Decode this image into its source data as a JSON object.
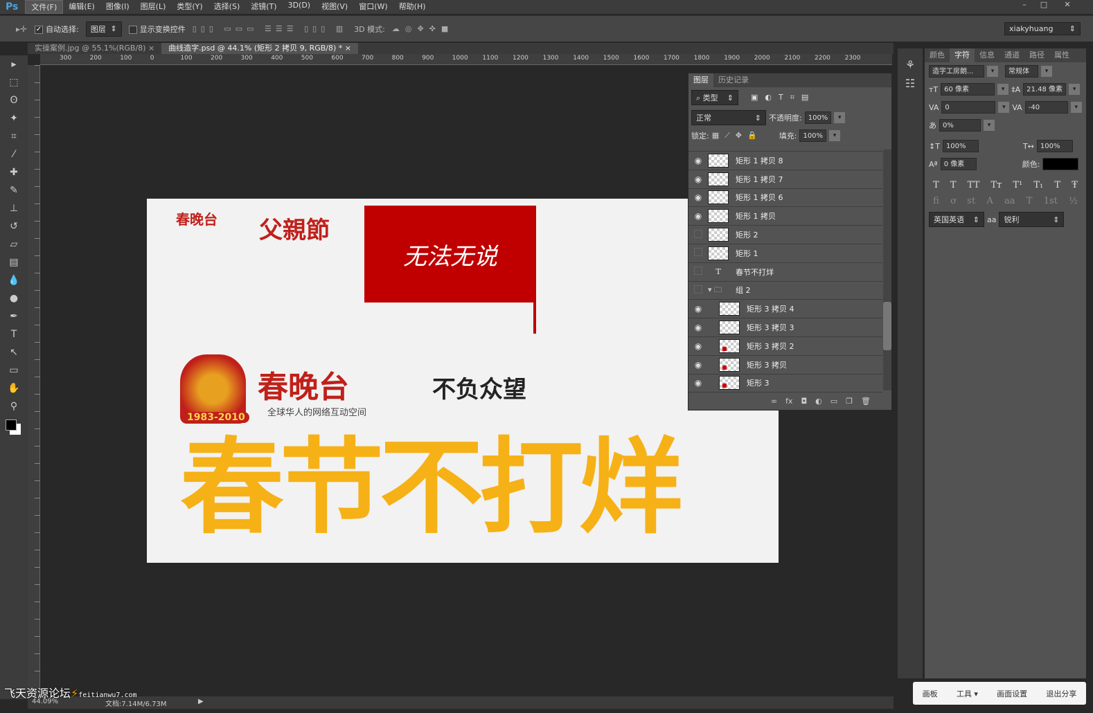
{
  "app": {
    "logo": "Ps",
    "user": "xiakyhuang"
  },
  "menu": [
    "文件(F)",
    "编辑(E)",
    "图像(I)",
    "图层(L)",
    "类型(Y)",
    "选择(S)",
    "滤镜(T)",
    "3D(D)",
    "视图(V)",
    "窗口(W)",
    "帮助(H)"
  ],
  "options": {
    "auto_select_label": "自动选择:",
    "auto_select_value": "图层",
    "show_transform_label": "显示变换控件",
    "mode3d_label": "3D 模式:"
  },
  "tabs": [
    {
      "label": "实操案例.jpg @ 55.1%(RGB/8)",
      "close": "×"
    },
    {
      "label": "曲线造字.psd @ 44.1% (矩形 2 拷贝 9, RGB/8) *",
      "close": "×"
    }
  ],
  "ruler_top": [
    "300",
    "200",
    "100",
    "0",
    "100",
    "200",
    "300",
    "400",
    "500",
    "600",
    "700",
    "800",
    "900",
    "1000",
    "1100",
    "1200",
    "1300",
    "1400",
    "1500",
    "1600",
    "1700",
    "1800",
    "1900",
    "2000",
    "2100",
    "2200",
    "2300"
  ],
  "canvas": {
    "logo1": "春晚台",
    "festival": "父親節",
    "red_box_text": "无法无说",
    "logo2": "春晚台",
    "logo2_years": "1983-2010",
    "logo2_slogan": "全球华人的网络互动空间",
    "black_text": "不负众望",
    "big_text": "春节不打烊",
    "colors": {
      "red": "#c00000",
      "orange": "#f6b117"
    }
  },
  "layers_panel": {
    "tabs": [
      "图层",
      "历史记录"
    ],
    "filter": "类型",
    "blend_mode": "正常",
    "opacity_label": "不透明度:",
    "opacity": "100%",
    "lock_label": "锁定:",
    "fill_label": "填充:",
    "fill": "100%",
    "layers": [
      {
        "name": "矩形 1 拷贝 8",
        "visible": true,
        "type": "raster",
        "indent": false
      },
      {
        "name": "矩形 1 拷贝 7",
        "visible": true,
        "type": "raster",
        "indent": false
      },
      {
        "name": "矩形 1 拷贝 6",
        "visible": true,
        "type": "raster",
        "indent": false
      },
      {
        "name": "矩形 1 拷贝",
        "visible": true,
        "type": "raster",
        "indent": false
      },
      {
        "name": "矩形 2",
        "visible": false,
        "type": "raster",
        "indent": false
      },
      {
        "name": "矩形 1",
        "visible": false,
        "type": "raster",
        "indent": false
      },
      {
        "name": "春节不打烊",
        "visible": false,
        "type": "text",
        "indent": false
      },
      {
        "name": "组 2",
        "visible": false,
        "type": "group",
        "indent": false
      },
      {
        "name": "矩形 3 拷贝 4",
        "visible": true,
        "type": "raster",
        "indent": true
      },
      {
        "name": "矩形 3 拷贝 3",
        "visible": true,
        "type": "raster",
        "indent": true
      },
      {
        "name": "矩形 3 拷贝 2",
        "visible": true,
        "type": "raster-red",
        "indent": true
      },
      {
        "name": "矩形 3 拷贝",
        "visible": true,
        "type": "raster-red",
        "indent": true
      },
      {
        "name": "矩形 3",
        "visible": true,
        "type": "raster-red",
        "indent": true
      }
    ],
    "footer_icons": [
      "∞",
      "fx",
      "◘",
      "◐",
      "▭",
      "❐",
      "🗑"
    ]
  },
  "character_panel": {
    "tabs": [
      "颜色",
      "字符",
      "信息",
      "通道",
      "路径",
      "属性"
    ],
    "font": "造字工房朗...",
    "style": "常规体",
    "size": "60 像素",
    "leading": "21.48 像素",
    "kerning": "0",
    "tracking": "-40",
    "scale_ratio": "0%",
    "vscale": "100%",
    "hscale": "100%",
    "baseline": "0 像素",
    "color_label": "颜色:",
    "language": "英国英语",
    "aa_label": "aa",
    "antialias": "锐利",
    "style_buttons": [
      "T",
      "T",
      "TT",
      "Tт",
      "T¹",
      "T₁",
      "T",
      "Ŧ"
    ],
    "ot_buttons": [
      "fi",
      "ơ",
      "st",
      "A",
      "aa",
      "T",
      "1st",
      "½"
    ]
  },
  "status": {
    "zoom": "44.09%",
    "doc": "文档:7.14M/6.73M"
  },
  "watermark": {
    "text": "飞天资源论坛",
    "url": "feitianwu7.com"
  },
  "sharebar": [
    "画板",
    "工具 ▾",
    "画面设置",
    "退出分享"
  ]
}
